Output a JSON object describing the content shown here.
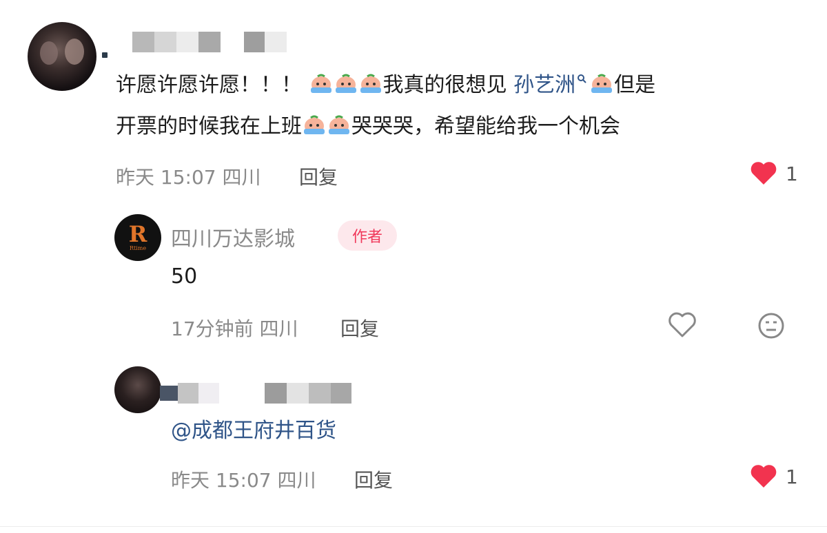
{
  "comment": {
    "line1_a": "许愿许愿许愿！！！",
    "line1_b": "我真的很想见",
    "mention_link": "孙艺洲",
    "line1_c": "但是",
    "line2_a": "开票的时候我在上班",
    "line2_b": "哭哭哭，希望能给我一个机会",
    "time": "昨天 15:07",
    "location": "四川",
    "reply_label": "回复",
    "likes": "1"
  },
  "author_reply": {
    "name": "四川万达影城",
    "badge": "作者",
    "avatar_letter": "R",
    "avatar_sub": "Rtime",
    "body": "50",
    "time": "17分钟前",
    "location": "四川",
    "reply_label": "回复"
  },
  "sub_reply": {
    "body": "@成都王府井百货",
    "time": "昨天 15:07",
    "location": "四川",
    "reply_label": "回复",
    "likes": "1"
  },
  "colors": {
    "heart": "#f2334f",
    "link": "#2f5488",
    "badge_bg": "#fde8ec",
    "badge_text": "#f0385a"
  },
  "icons": [
    "crying-emoji-icon",
    "search-mini-icon",
    "heart-filled-icon",
    "heart-outline-icon",
    "emoji-face-icon"
  ]
}
